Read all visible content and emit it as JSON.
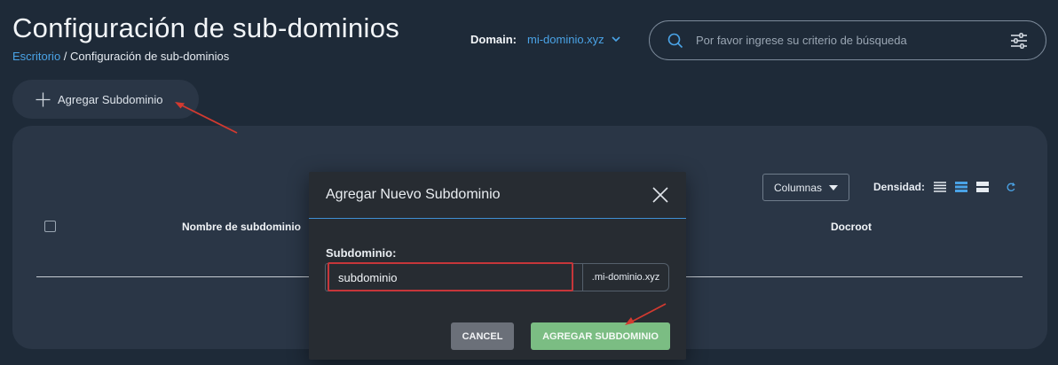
{
  "page": {
    "title": "Configuración de sub-dominios",
    "breadcrumb_home": "Escritorio",
    "breadcrumb_separator": " / ",
    "breadcrumb_current": "Configuración de sub-dominios"
  },
  "domain": {
    "label": "Domain:",
    "selected": "mi-dominio.xyz"
  },
  "search": {
    "placeholder": "Por favor ingrese su criterio de búsqueda",
    "icons": [
      "search-icon",
      "filter-sliders-icon"
    ]
  },
  "toolbar": {
    "add_label": "Agregar Subdominio",
    "add_icon": "plus-icon"
  },
  "table": {
    "columns_button": "Columnas",
    "density_label": "Densidad:",
    "density_selected": "standard",
    "headers": [
      "Nombre de subdominio",
      "Docroot"
    ]
  },
  "modal": {
    "title": "Agregar Nuevo Subdominio",
    "field_label": "Subdominio:",
    "input_value": "subdominio",
    "addon": ".mi-dominio.xyz",
    "cancel_label": "CANCEL",
    "submit_label": "AGREGAR SUBDOMINIO"
  },
  "colors": {
    "background": "#1e2a38",
    "card": "#2a3646",
    "accent": "#4aa3e6",
    "modal": "#272c32",
    "highlight": "#c6363a",
    "submit": "#7bbd83",
    "cancel": "#6b7079"
  }
}
